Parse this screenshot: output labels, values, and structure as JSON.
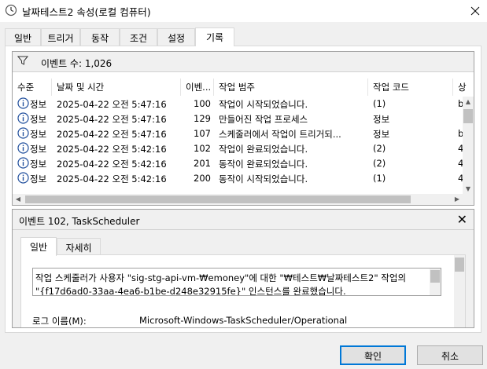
{
  "window": {
    "title": "날짜테스트2 속성(로컬 컴퓨터)",
    "icon": "clock-icon",
    "close_icon": "close-icon"
  },
  "tabs": [
    {
      "label": "일반"
    },
    {
      "label": "트리거"
    },
    {
      "label": "동작"
    },
    {
      "label": "조건"
    },
    {
      "label": "설정"
    },
    {
      "label": "기록",
      "active": true
    }
  ],
  "history": {
    "filter_icon": "funnel-icon",
    "event_count": "이벤트 수: 1,026",
    "columns": [
      "수준",
      "날짜 및 시간",
      "이벤...",
      "작업 범주",
      "작업 코드",
      "상"
    ],
    "rows": [
      {
        "level": "정보",
        "datetime": "2025-04-22 오전 5:47:16",
        "event_id": "100",
        "category": "작업이 시작되었습니다.",
        "opcode": "(1)",
        "extra": "b"
      },
      {
        "level": "정보",
        "datetime": "2025-04-22 오전 5:47:16",
        "event_id": "129",
        "category": "만들어진 작업 프로세스",
        "opcode": "정보",
        "extra": ""
      },
      {
        "level": "정보",
        "datetime": "2025-04-22 오전 5:47:16",
        "event_id": "107",
        "category": "스케줄러에서 작업이 트리거되...",
        "opcode": "정보",
        "extra": "b"
      },
      {
        "level": "정보",
        "datetime": "2025-04-22 오전 5:42:16",
        "event_id": "102",
        "category": "작업이 완료되었습니다.",
        "opcode": "(2)",
        "extra": "4"
      },
      {
        "level": "정보",
        "datetime": "2025-04-22 오전 5:42:16",
        "event_id": "201",
        "category": "동작이 완료되었습니다.",
        "opcode": "(2)",
        "extra": "4"
      },
      {
        "level": "정보",
        "datetime": "2025-04-22 오전 5:42:16",
        "event_id": "200",
        "category": "동작이 시작되었습니다.",
        "opcode": "(1)",
        "extra": "4"
      }
    ]
  },
  "detail": {
    "title": "이벤트 102, TaskScheduler",
    "close_icon": "close-icon",
    "subtabs": [
      {
        "label": "일반",
        "active": true
      },
      {
        "label": "자세히"
      }
    ],
    "description_lines": [
      "작업 스케줄러가 사용자 \"sig-stg-api-vm-₩emoney\"에 대한 \"₩테스트₩날짜테스트2\" 작업의",
      "\"{f17d6ad0-33aa-4ea6-b1be-d248e32915fe}\" 인스턴스를 완료했습니다."
    ],
    "log_name_label": "로그 이름(M):",
    "log_name_value": "Microsoft-Windows-TaskScheduler/Operational"
  },
  "buttons": {
    "ok": "확인",
    "cancel": "취소"
  },
  "colors": {
    "accent": "#0078d7",
    "info_icon": "#1f4e9c"
  }
}
